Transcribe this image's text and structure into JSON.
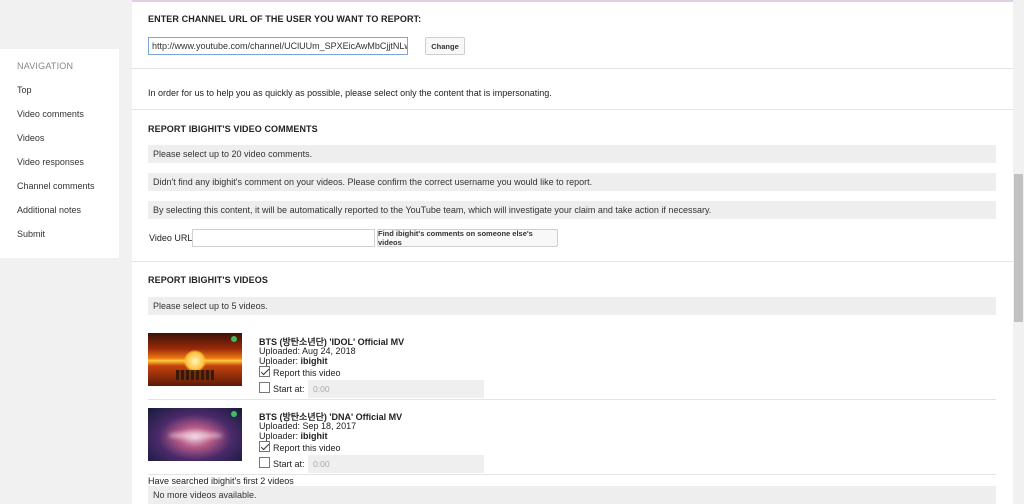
{
  "sidebar": {
    "heading": "NAVIGATION",
    "items": [
      {
        "label": "Top"
      },
      {
        "label": "Video comments"
      },
      {
        "label": "Videos"
      },
      {
        "label": "Video responses"
      },
      {
        "label": "Channel comments"
      },
      {
        "label": "Additional notes"
      },
      {
        "label": "Submit"
      }
    ]
  },
  "channel": {
    "heading": "ENTER CHANNEL URL OF THE USER YOU WANT TO REPORT:",
    "url_value": "http://www.youtube.com/channel/UClUUm_SPXEicAwMbCjjtNLw",
    "change_label": "Change"
  },
  "intro_text": "In order for us to help you as quickly as possible, please select only the content that is impersonating.",
  "comments": {
    "heading": "REPORT IBIGHIT'S VIDEO COMMENTS",
    "notice_select": "Please select up to 20 video comments.",
    "notice_none": "Didn't find any ibighit's comment on your videos. Please confirm the correct username you would like to report.",
    "notice_report": "By selecting this content, it will be automatically reported to the YouTube team, which will investigate your claim and take action if necessary.",
    "video_url_label": "Video URL",
    "find_button": "Find ibighit's comments on someone else's videos"
  },
  "videos": {
    "heading": "REPORT IBIGHIT'S VIDEOS",
    "notice_select": "Please select up to 5 videos.",
    "items": [
      {
        "title": "BTS (방탄소년단) 'IDOL' Official MV",
        "uploaded": "Uploaded: Aug 24, 2018",
        "uploader_label": "Uploader:",
        "uploader": "ibighit",
        "report_label": "Report this video",
        "report_checked": true,
        "start_label": "Start at:",
        "start_placeholder": "0:00"
      },
      {
        "title": "BTS (방탄소년단) 'DNA' Official MV",
        "uploaded": "Uploaded: Sep 18, 2017",
        "uploader_label": "Uploader:",
        "uploader": "ibighit",
        "report_label": "Report this video",
        "report_checked": true,
        "start_label": "Start at:",
        "start_placeholder": "0:00"
      }
    ],
    "searched_text": "Have searched ibighit's first 2 videos",
    "no_more_text": "No more videos available."
  },
  "colors": {
    "page_bg": "#f1f1f1",
    "input_border": "#7aa7d9",
    "checkbox_badge": "#3bbf5a"
  }
}
